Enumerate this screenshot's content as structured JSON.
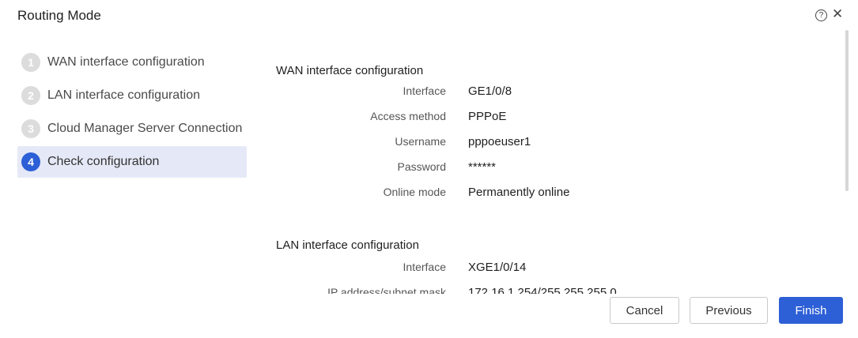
{
  "dialog": {
    "title": "Routing Mode",
    "help_icon": "?",
    "close_icon": "✕"
  },
  "steps": [
    {
      "number": "1",
      "label": "WAN interface configuration",
      "active": false
    },
    {
      "number": "2",
      "label": "LAN interface configuration",
      "active": false
    },
    {
      "number": "3",
      "label": "Cloud Manager Server Connection",
      "active": false
    },
    {
      "number": "4",
      "label": "Check configuration",
      "active": true
    }
  ],
  "wan": {
    "title": "WAN interface configuration",
    "rows": [
      {
        "key": "Interface",
        "value": "GE1/0/8"
      },
      {
        "key": "Access method",
        "value": "PPPoE"
      },
      {
        "key": "Username",
        "value": "pppoeuser1"
      },
      {
        "key": "Password",
        "value": "******"
      },
      {
        "key": "Online mode",
        "value": "Permanently online"
      }
    ]
  },
  "lan": {
    "title": "LAN interface configuration",
    "rows": [
      {
        "key": "Interface",
        "value": "XGE1/0/14"
      },
      {
        "key": "IP address/subnet mask",
        "value": "172.16.1.254/255.255.255.0"
      }
    ]
  },
  "buttons": {
    "cancel": "Cancel",
    "previous": "Previous",
    "finish": "Finish"
  },
  "colors": {
    "accent": "#2d5fd6",
    "active_step_bg": "#e5e9f7"
  }
}
